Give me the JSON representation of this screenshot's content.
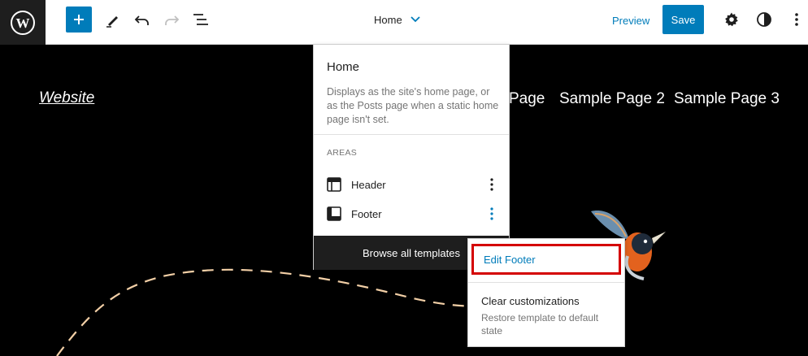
{
  "toolbar": {
    "logo_icon": "wordpress-logo-icon",
    "add_icon": "plus-icon",
    "tools_icon": "pencil-icon",
    "undo_icon": "undo-icon",
    "redo_icon": "redo-icon",
    "list_view_icon": "list-view-icon",
    "document_title": "Home",
    "title_chevron_icon": "chevron-down-icon",
    "preview_label": "Preview",
    "save_label": "Save",
    "settings_icon": "gear-icon",
    "styles_icon": "half-circle-icon",
    "options_icon": "vertical-ellipsis-icon",
    "accent_color": "#007cba"
  },
  "site": {
    "title": "Website",
    "nav": [
      "Page",
      "Sample Page 2",
      "Sample Page 3"
    ],
    "background_color": "#000000"
  },
  "template_popover": {
    "title": "Home",
    "description": "Displays as the site's home page, or as the Posts page when a static home page isn't set.",
    "areas_heading": "AREAS",
    "areas": [
      {
        "label": "Header",
        "icon": "header-layout-icon"
      },
      {
        "label": "Footer",
        "icon": "footer-layout-icon"
      }
    ],
    "browse_label": "Browse all templates"
  },
  "area_menu": {
    "edit_label": "Edit Footer",
    "clear_label": "Clear customizations",
    "clear_description": "Restore template to default state",
    "highlight_color": "#d40000"
  }
}
